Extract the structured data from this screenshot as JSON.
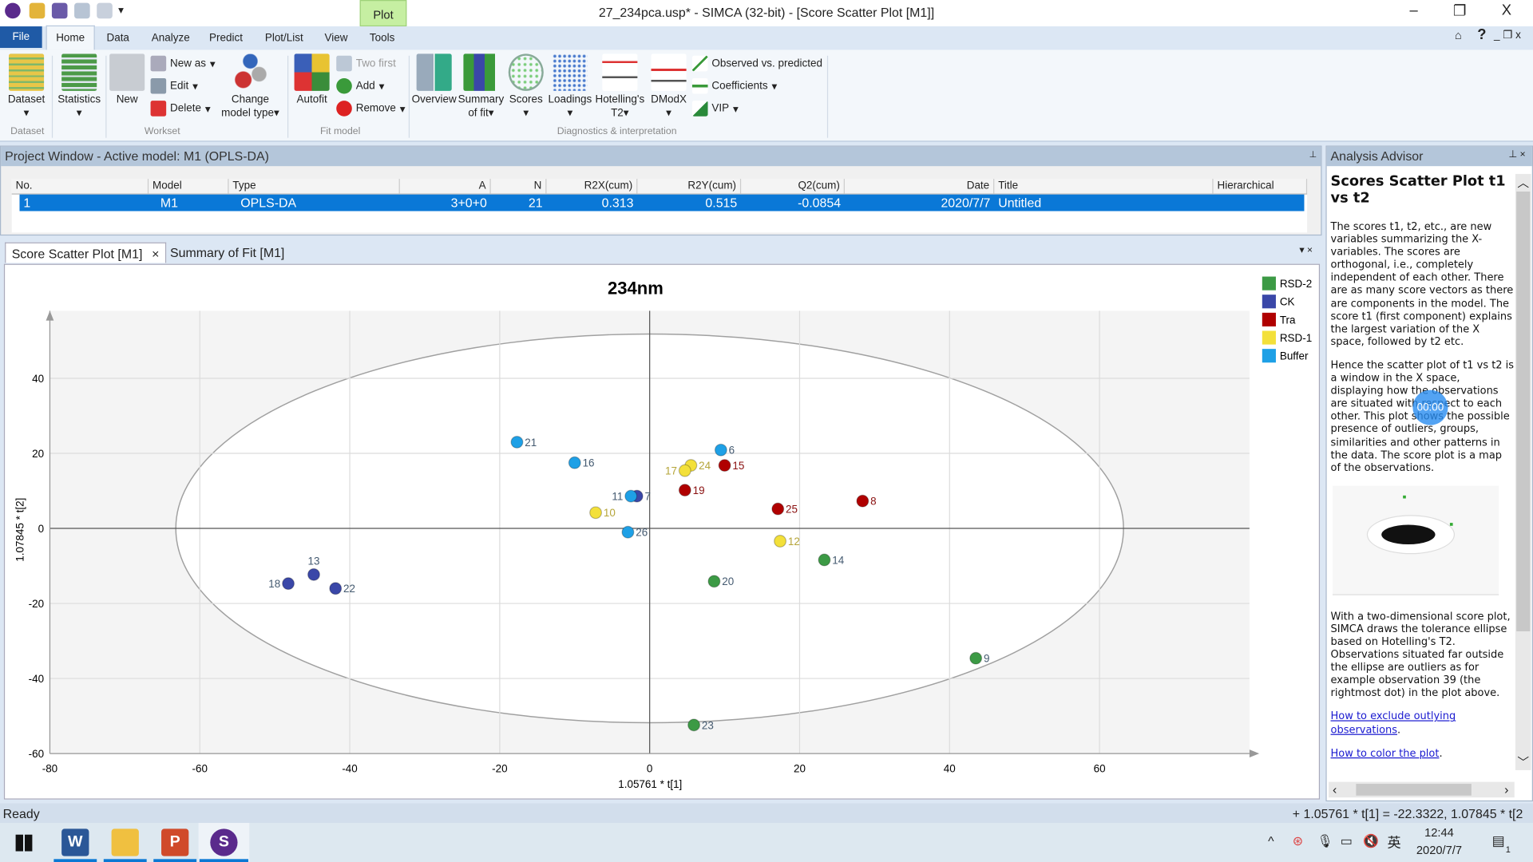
{
  "window": {
    "title": "27_234pca.usp* - SIMCA (32-bit) - [Score Scatter Plot [M1]]",
    "context_tab": "Plot",
    "minimize": "–",
    "restore": "❐",
    "close": "X"
  },
  "menu_tabs": [
    "File",
    "Home",
    "Data",
    "Analyze",
    "Predict",
    "Plot/List",
    "View",
    "Tools"
  ],
  "ribbon": {
    "dataset": "Dataset",
    "statistics": "Statistics",
    "new": "New",
    "new_as": "New as",
    "edit": "Edit",
    "delete": "Delete",
    "change_model_type": "Change model type",
    "autofit": "Autofit",
    "two_first": "Two first",
    "add": "Add",
    "remove": "Remove",
    "overview": "Overview",
    "summary_of_fit": "Summary of fit",
    "scores": "Scores",
    "loadings": "Loadings",
    "hotellings": "Hotelling's T2",
    "dmodx": "DModX",
    "observed_vs_predicted": "Observed vs. predicted",
    "coefficients": "Coefficients",
    "vip": "VIP",
    "groups": [
      "Dataset",
      "Workset",
      "Fit model",
      "Diagnostics & interpretation"
    ]
  },
  "project": {
    "title": "Project Window - Active model: M1 (OPLS-DA)",
    "columns": [
      "No.",
      "Model",
      "Type",
      "A",
      "N",
      "R2X(cum)",
      "R2Y(cum)",
      "Q2(cum)",
      "Date",
      "Title",
      "Hierarchical"
    ],
    "rows": [
      [
        "1",
        "M1",
        "OPLS-DA",
        "3+0+0",
        "21",
        "0.313",
        "0.515",
        "-0.0854",
        "2020/7/7",
        "Untitled",
        ""
      ]
    ]
  },
  "doc_tabs": [
    {
      "label": "Score Scatter Plot [M1]",
      "active": true
    },
    {
      "label": "Summary of Fit [M1]",
      "active": false
    }
  ],
  "chart_data": {
    "type": "scatter",
    "title": "234nm",
    "xlabel": "1.05761 * t[1]",
    "ylabel": "1.07845 * t[2]",
    "xlim": [
      -80,
      80
    ],
    "ylim": [
      -60,
      58
    ],
    "xticks": [
      -80,
      -60,
      -40,
      -20,
      0,
      20,
      40,
      60
    ],
    "yticks": [
      -60,
      -40,
      -20,
      0,
      20,
      40
    ],
    "grid": true,
    "legend_position": "top-right",
    "ellipse": {
      "center": [
        0,
        0
      ],
      "semi_axes": [
        63.2,
        51.8
      ]
    },
    "series": [
      {
        "name": "RSD-2",
        "color": "#3c9a45",
        "points": [
          {
            "label": "14",
            "x": 23.3,
            "y": -8.4
          },
          {
            "label": "20",
            "x": 8.6,
            "y": -14.1
          },
          {
            "label": "9",
            "x": 43.5,
            "y": -34.6
          },
          {
            "label": "23",
            "x": 5.9,
            "y": -52.4
          }
        ]
      },
      {
        "name": "CK",
        "color": "#3a47a8",
        "points": [
          {
            "label": "7",
            "x": -1.7,
            "y": 8.6
          },
          {
            "label": "13",
            "x": -44.8,
            "y": -12.3
          },
          {
            "label": "18",
            "x": -48.2,
            "y": -14.7
          },
          {
            "label": "22",
            "x": -41.9,
            "y": -16.0
          }
        ]
      },
      {
        "name": "Tra",
        "color": "#b00000",
        "points": [
          {
            "label": "15",
            "x": 10.0,
            "y": 16.8
          },
          {
            "label": "19",
            "x": 4.7,
            "y": 10.2
          },
          {
            "label": "25",
            "x": 17.1,
            "y": 5.2
          },
          {
            "label": "8",
            "x": 28.4,
            "y": 7.3
          }
        ]
      },
      {
        "name": "RSD-1",
        "color": "#f3e03a",
        "points": [
          {
            "label": "24",
            "x": 5.5,
            "y": 16.8
          },
          {
            "label": "17",
            "x": 4.7,
            "y": 15.4
          },
          {
            "label": "10",
            "x": -7.2,
            "y": 4.2
          },
          {
            "label": "12",
            "x": 17.4,
            "y": -3.4
          }
        ]
      },
      {
        "name": "Buffer",
        "color": "#1ea0e6",
        "points": [
          {
            "label": "21",
            "x": -17.7,
            "y": 23.0
          },
          {
            "label": "16",
            "x": -10.0,
            "y": 17.5
          },
          {
            "label": "11",
            "x": -2.5,
            "y": 8.6
          },
          {
            "label": "26",
            "x": -2.9,
            "y": -1.0
          },
          {
            "label": "6",
            "x": 9.5,
            "y": 20.9
          }
        ]
      }
    ]
  },
  "advisor": {
    "title": "Analysis Advisor",
    "heading": "Scores Scatter Plot t1 vs t2",
    "p1": "The scores t1, t2, etc., are new variables summarizing the X-variables. The scores are orthogonal, i.e., completely independent of each other. There are as many score vectors as there are components in the model. The score t1 (first component) explains the largest variation of the X space, followed by t2 etc.",
    "p2": "Hence the scatter plot of t1 vs t2 is a window in the X space, displaying how the observations are situated with respect to each other. This plot shows the possible presence of outliers, groups, similarities and other patterns in the data. The score plot is a map of the observations.",
    "p3": "With a two-dimensional score plot, SIMCA draws the tolerance ellipse based on Hotelling's T2. Observations situated far outside the ellipse are outliers as for example observation 39 (the rightmost dot) in the plot above.",
    "link1": "How to exclude outlying observations",
    "link2": "How to color the plot",
    "timer": "00:00"
  },
  "status": {
    "left": "Ready",
    "right": "+ 1.05761 * t[1] = -22.3322, 1.07845 * t[2"
  },
  "taskbar": {
    "time": "12:44",
    "date": "2020/7/7",
    "ime": "英",
    "notifications": "1"
  }
}
